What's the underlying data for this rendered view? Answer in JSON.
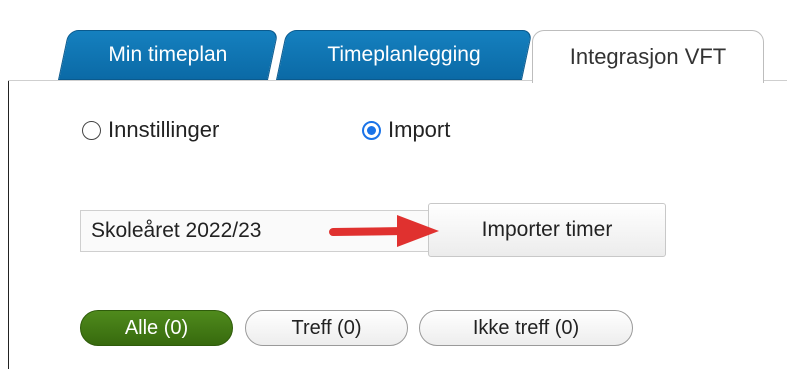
{
  "tabs": [
    {
      "label": "Min timeplan",
      "active": false
    },
    {
      "label": "Timeplanlegging",
      "active": false
    },
    {
      "label": "Integrasjon VFT",
      "active": true
    }
  ],
  "mode": {
    "options": [
      {
        "label": "Innstillinger",
        "checked": false
      },
      {
        "label": "Import",
        "checked": true
      }
    ]
  },
  "import": {
    "school_year": "Skoleåret 2022/23",
    "button_label": "Importer timer"
  },
  "filters": [
    {
      "label": "Alle (0)",
      "active": true
    },
    {
      "label": "Treff (0)",
      "active": false
    },
    {
      "label": "Ikke treff (0)",
      "active": false
    }
  ],
  "colors": {
    "tab_blue": "#0b6aa6",
    "radio_accent": "#1a73e8",
    "filter_active": "#376a0e",
    "arrow": "#e0312f"
  }
}
